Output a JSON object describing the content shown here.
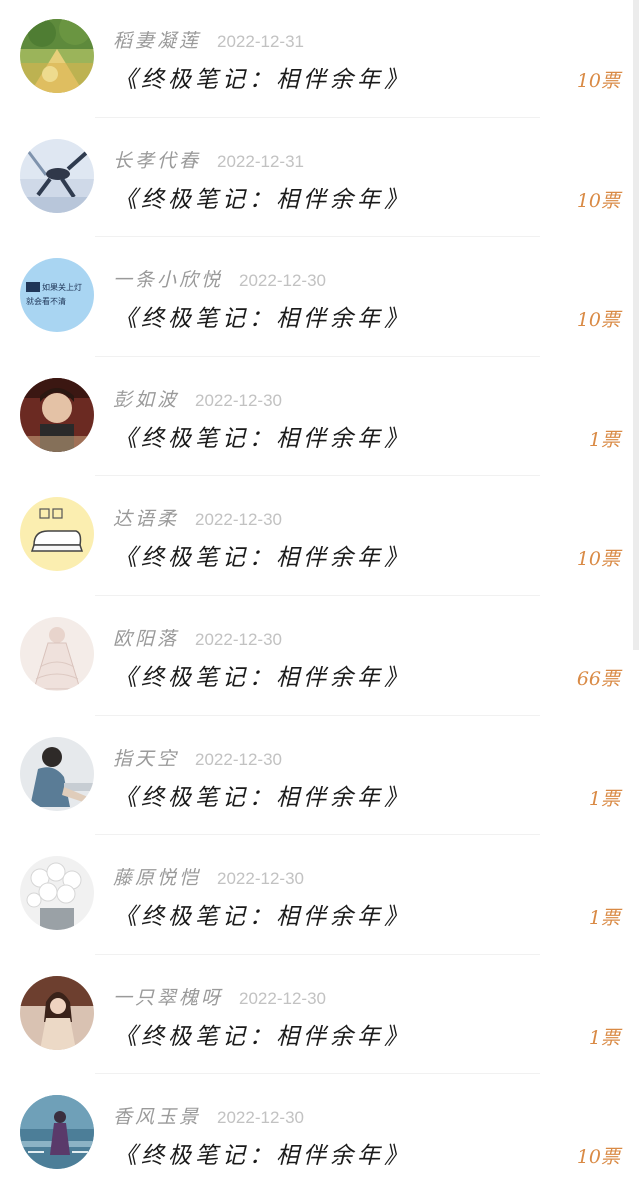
{
  "items": [
    {
      "name": "稻妻凝莲",
      "date": "2022-12-31",
      "title": "《终极笔记：相伴余年》",
      "amount": "10票",
      "avatar_icon": "avatar-forest-road-icon"
    },
    {
      "name": "长孝代春",
      "date": "2022-12-31",
      "title": "《终极笔记：相伴余年》",
      "amount": "10票",
      "avatar_icon": "avatar-jumping-figure-icon"
    },
    {
      "name": "一条小欣悦",
      "date": "2022-12-30",
      "title": "《终极笔记：相伴余年》",
      "amount": "10票",
      "avatar_icon": "avatar-text-card-icon",
      "avatar_text": [
        "如果关上灯",
        "就会看不清"
      ]
    },
    {
      "name": "彭如波",
      "date": "2022-12-30",
      "title": "《终极笔记：相伴余年》",
      "amount": "1票",
      "avatar_icon": "avatar-portrait-icon"
    },
    {
      "name": "达语柔",
      "date": "2022-12-30",
      "title": "《终极笔记：相伴余年》",
      "amount": "10票",
      "avatar_icon": "avatar-bread-cartoon-icon"
    },
    {
      "name": "欧阳落",
      "date": "2022-12-30",
      "title": "《终极笔记：相伴余年》",
      "amount": "66票",
      "avatar_icon": "avatar-lace-dress-icon"
    },
    {
      "name": "指天空",
      "date": "2022-12-30",
      "title": "《终极笔记：相伴余年》",
      "amount": "1票",
      "avatar_icon": "avatar-sitting-person-icon"
    },
    {
      "name": "藤原悦恺",
      "date": "2022-12-30",
      "title": "《终极笔记：相伴余年》",
      "amount": "1票",
      "avatar_icon": "avatar-white-flowers-icon"
    },
    {
      "name": "一只翠槐呀",
      "date": "2022-12-30",
      "title": "《终极笔记：相伴余年》",
      "amount": "1票",
      "avatar_icon": "avatar-girl-icon"
    },
    {
      "name": "香风玉景",
      "date": "2022-12-30",
      "title": "《终极笔记：相伴余年》",
      "amount": "10票",
      "avatar_icon": "avatar-seaside-figure-icon"
    }
  ],
  "colors": {
    "name": "#9a9a9a",
    "date": "#c2c2c2",
    "title": "#1a1a1a",
    "amount": "#d98a45",
    "divider": "#f1f1f1"
  }
}
